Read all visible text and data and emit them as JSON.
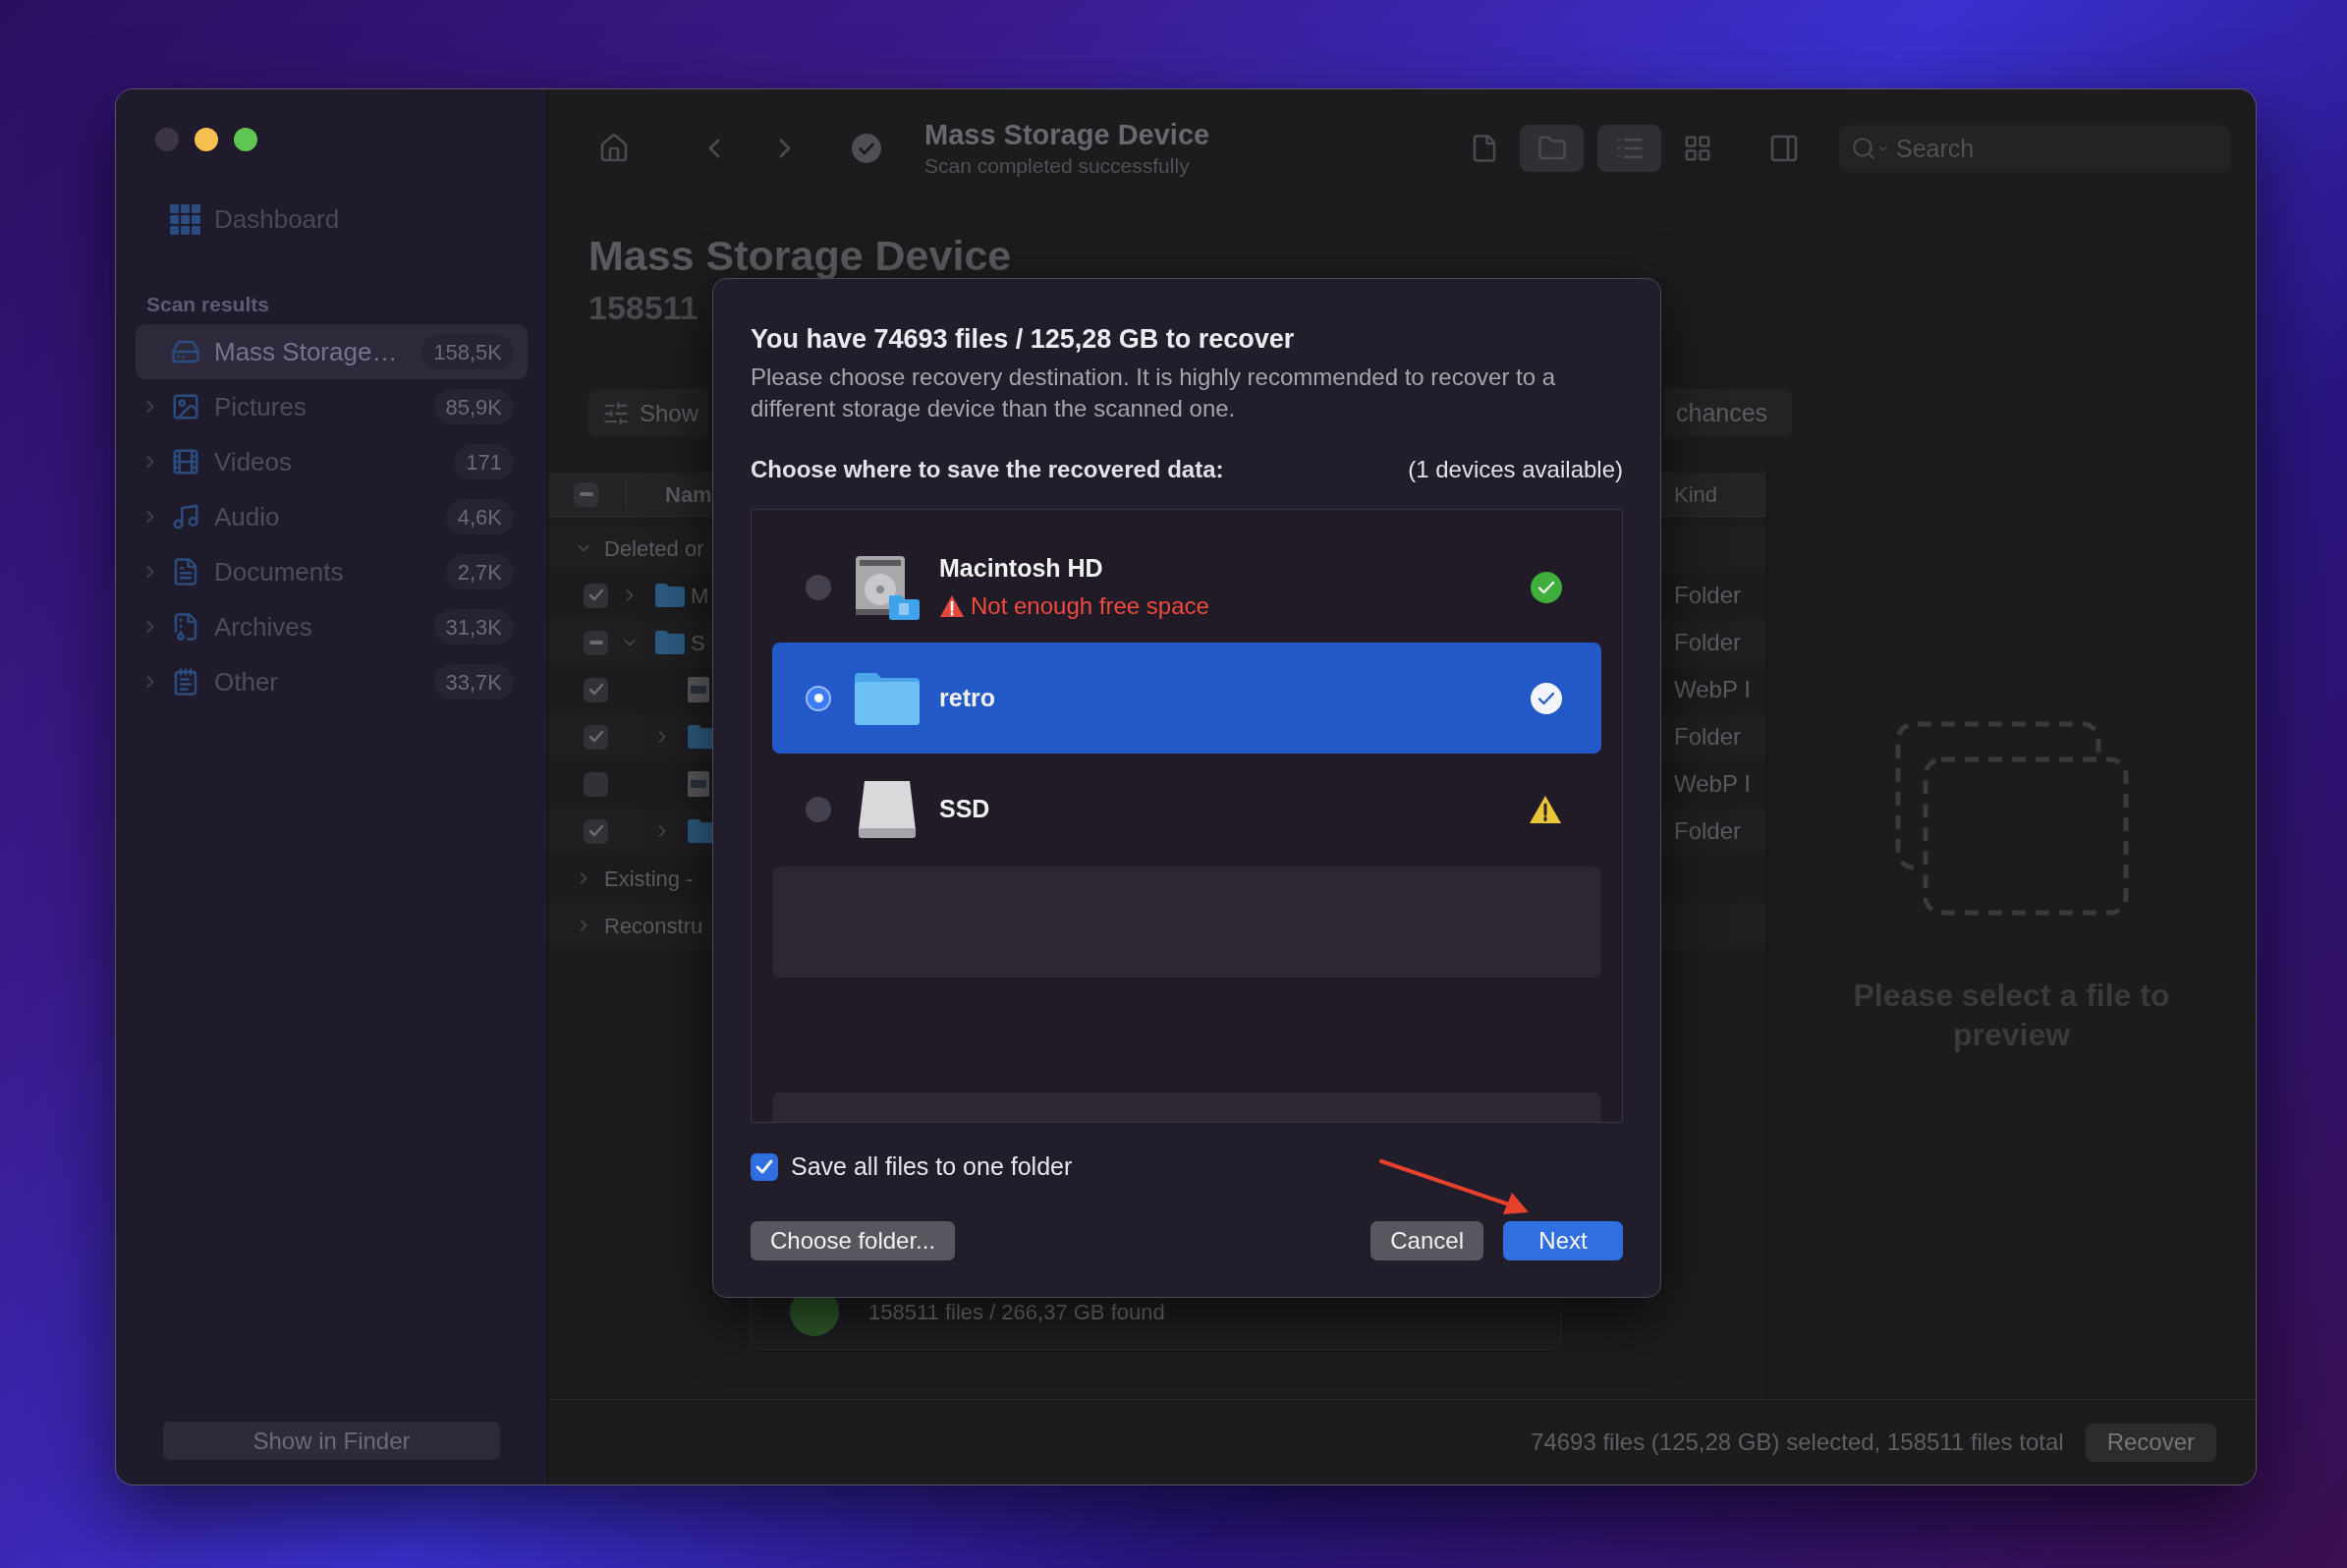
{
  "window": {
    "traffic_lights": [
      {
        "color": "#3b3545"
      },
      {
        "color": "#f6c04f"
      },
      {
        "color": "#5ec651"
      }
    ]
  },
  "sidebar": {
    "dashboard": "Dashboard",
    "section": "Scan results",
    "items": [
      {
        "kind": "drive",
        "label": "Mass Storage…",
        "count": "158,5K",
        "selected": true
      },
      {
        "kind": "pictures",
        "label": "Pictures",
        "count": "85,9K",
        "selected": false,
        "expanded": false
      },
      {
        "kind": "videos",
        "label": "Videos",
        "count": "171",
        "selected": false,
        "expanded": false
      },
      {
        "kind": "audio",
        "label": "Audio",
        "count": "4,6K",
        "selected": false,
        "expanded": false
      },
      {
        "kind": "documents",
        "label": "Documents",
        "count": "2,7K",
        "selected": false,
        "expanded": false
      },
      {
        "kind": "archives",
        "label": "Archives",
        "count": "31,3K",
        "selected": false,
        "expanded": false
      },
      {
        "kind": "other",
        "label": "Other",
        "count": "33,7K",
        "selected": false,
        "expanded": false
      }
    ],
    "footer_button": "Show in Finder"
  },
  "toolbar": {
    "title": "Mass Storage Device",
    "subtitle": "Scan completed successfully",
    "view_buttons": [
      {
        "kind": "file",
        "selected": false
      },
      {
        "kind": "folder",
        "selected": true
      }
    ],
    "layout_buttons": [
      {
        "kind": "list",
        "selected": true
      },
      {
        "kind": "grid",
        "selected": false
      }
    ],
    "search": {
      "placeholder": "Search"
    }
  },
  "header": {
    "title": "Mass Storage Device",
    "subtitle": "158511"
  },
  "filters": {
    "left": "Show",
    "right": "chances"
  },
  "table": {
    "select_all": {
      "mixed": true
    },
    "columns": [
      "Nam",
      "Kind"
    ],
    "groups": [
      {
        "label": "Deleted or",
        "expanded": true,
        "rows": [
          {
            "kind": "folder",
            "name": "M",
            "file_kind": "Folder",
            "checked": true,
            "mixed": false,
            "expanded": false
          },
          {
            "kind": "folder",
            "name": "S",
            "file_kind": "Folder",
            "mixed": true,
            "expanded": true,
            "children": [
              {
                "kind": "file",
                "file_kind": "WebP I",
                "checked": true,
                "mixed": false
              },
              {
                "kind": "folder",
                "file_kind": "Folder",
                "checked": true,
                "mixed": false,
                "expanded": false
              },
              {
                "kind": "file",
                "file_kind": "WebP I",
                "checked": false,
                "mixed": false
              },
              {
                "kind": "folder",
                "file_kind": "Folder",
                "checked": true,
                "mixed": false,
                "expanded": false
              }
            ]
          }
        ]
      },
      {
        "label": "Existing -",
        "expanded": false
      },
      {
        "label": "Reconstru",
        "expanded": false
      }
    ]
  },
  "result_card": {
    "text": "158511 files / 266,37 GB found"
  },
  "preview": {
    "message": "Please select a file to preview"
  },
  "status_bar": {
    "summary": "74693 files (125,28 GB) selected, 158511 files total",
    "button": "Recover"
  },
  "dialog": {
    "title": "You have 74693 files / 125,28 GB to recover",
    "description": "Please choose recovery destination. It is highly recommended to recover to a different storage device than the scanned one.",
    "prompt": "Choose where to save the recovered data:",
    "availability": "(1 devices available)",
    "destinations": [
      {
        "kind": "disk",
        "name": "Macintosh HD",
        "note": "Not enough free space",
        "warning": false,
        "selected": false
      },
      {
        "kind": "folder",
        "name": "retro",
        "warning": false,
        "selected": true
      },
      {
        "kind": "drive",
        "name": "SSD",
        "warning": true,
        "selected": false
      }
    ],
    "save_to_one_folder": {
      "label": "Save all files to one folder",
      "checked": true
    },
    "buttons": [
      {
        "label": "Choose folder...",
        "kind": "secondary"
      },
      {
        "label": "Cancel",
        "kind": "secondary"
      },
      {
        "label": "Next",
        "kind": "primary"
      }
    ]
  }
}
